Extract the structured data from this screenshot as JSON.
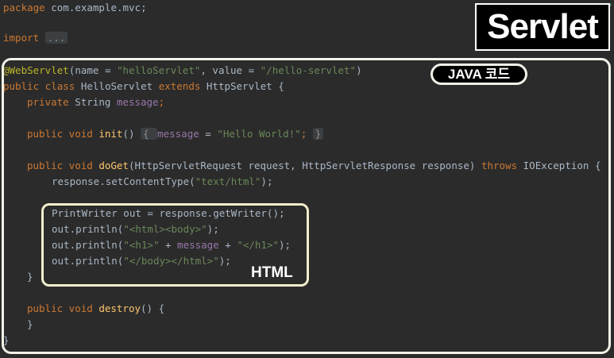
{
  "editor": {
    "lines": {
      "package": {
        "kw": "package ",
        "rest": "com.example.mvc;"
      },
      "imports": {
        "kw": "import ",
        "fold": "..."
      },
      "annotation": {
        "ann": "@WebServlet",
        "open": "(name = ",
        "name_val": "\"helloServlet\"",
        "mid": ", value = ",
        "value_val": "\"/hello-servlet\"",
        "close": ")"
      },
      "class_decl": {
        "kw1": "public class ",
        "name": "HelloServlet ",
        "kw2": "extends ",
        "rest": "HttpServlet {"
      },
      "field": {
        "kw": "private ",
        "type": "String ",
        "fld": "message",
        "end": ";"
      },
      "init": {
        "kw": "public void ",
        "fn": "init",
        "parens": "() ",
        "fold_open": "{ ",
        "fld": "message",
        "eq": " = ",
        "str": "\"Hello World!\"",
        "semi": "; ",
        "fold_close": "}"
      },
      "doget": {
        "kw": "public void ",
        "fn": "doGet",
        "params": "(HttpServletRequest request, HttpServletResponse response) ",
        "kw2": "throws ",
        "rest": "IOException {"
      },
      "set_content": {
        "pre": "response.setContentType(",
        "str": "\"text/html\"",
        "post": ");"
      },
      "writer": {
        "text": "PrintWriter out = response.getWriter();"
      },
      "print1": {
        "pre": "out.println(",
        "str": "\"<html><body>\"",
        "post": ");"
      },
      "print2": {
        "pre": "out.println(",
        "str1": "\"<h1>\"",
        "plus1": " + ",
        "fld": "message",
        "plus2": " + ",
        "str2": "\"</h1>\"",
        "post": ");"
      },
      "print3": {
        "pre": "out.println(",
        "str": "\"</body></html>\"",
        "post": ");"
      },
      "close_doget": "}",
      "destroy": {
        "kw": "public void ",
        "fn": "destroy",
        "rest": "() {"
      },
      "close_destroy": "}",
      "close_class": "}"
    }
  },
  "overlays": {
    "servlet_badge": "Servlet",
    "java_label": "JAVA 코드",
    "html_label": "HTML"
  },
  "colors": {
    "background": "#2b2b2b",
    "keyword": "#cc7832",
    "string": "#6a8759",
    "function": "#ffc66d",
    "annotation": "#bbb529",
    "field": "#9876aa",
    "text": "#a9b7c6",
    "check": "#59a869"
  },
  "icons": {
    "status": "check-icon"
  }
}
